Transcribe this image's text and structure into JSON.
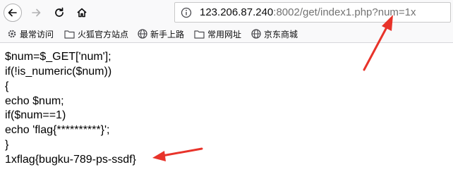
{
  "browser": {
    "url": {
      "host": "123.206.87.240",
      "rest": ":8002/get/index1.php?num=1x"
    }
  },
  "bookmarks": [
    {
      "label": "最常访问",
      "icon": "gear-icon"
    },
    {
      "label": "火狐官方站点",
      "icon": "folder-icon"
    },
    {
      "label": "新手上路",
      "icon": "globe-icon"
    },
    {
      "label": "常用网址",
      "icon": "folder-icon"
    },
    {
      "label": "京东商城",
      "icon": "globe-icon"
    }
  ],
  "page": {
    "lines": [
      "$num=$_GET['num'];",
      "if(!is_numeric($num))",
      "{",
      "echo $num;",
      "if($num==1)",
      "echo 'flag{**********}';",
      "}",
      "1xflag{bugku-789-ps-ssdf}"
    ]
  },
  "annotations": {
    "arrow_color": "#e8332a"
  }
}
